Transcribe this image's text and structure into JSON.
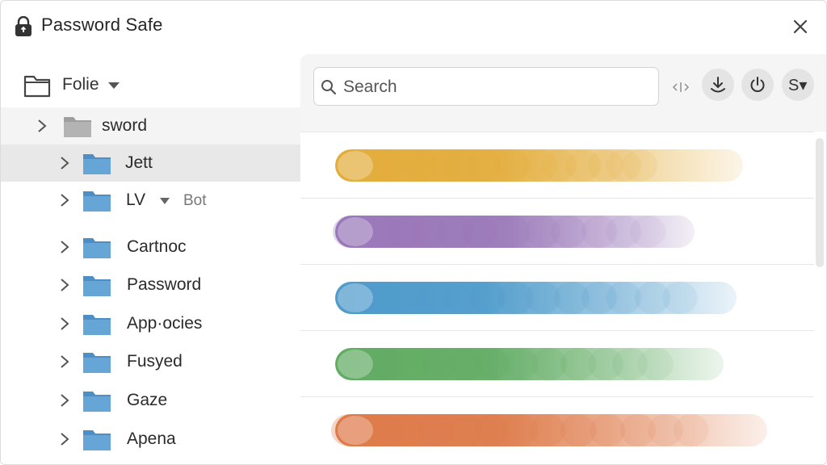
{
  "window": {
    "title": "Password Safe"
  },
  "sidebar": {
    "folder_selector": {
      "label": "Folie"
    },
    "root": {
      "label": "sword"
    },
    "items": [
      {
        "label": "Jett"
      },
      {
        "label": "LV",
        "badge": "Bot"
      },
      {
        "label": "Cartnoc"
      },
      {
        "label": "Password"
      },
      {
        "label": "App·ocies"
      },
      {
        "label": "Fusyed"
      },
      {
        "label": "Gaze"
      },
      {
        "label": "Apena"
      }
    ]
  },
  "toolbar": {
    "search_placeholder": "Search",
    "sort_label": "S▾"
  },
  "entries": [
    {
      "color": "#e3ad3c"
    },
    {
      "color": "#9a78b9"
    },
    {
      "color": "#4f9bcb"
    },
    {
      "color": "#62ac64"
    },
    {
      "color": "#de7b4b"
    }
  ],
  "icons": {
    "app": "lock-icon",
    "close": "close-icon",
    "folder": "folder-icon",
    "search": "search-icon",
    "download": "download-icon",
    "power": "power-icon"
  }
}
